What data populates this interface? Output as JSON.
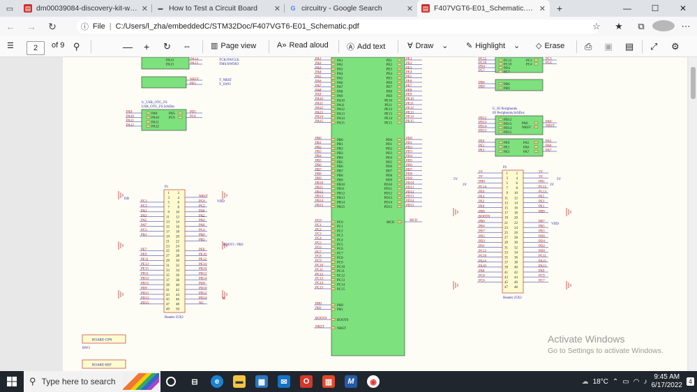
{
  "browser": {
    "tabs": [
      {
        "label": "dm00039084-discovery-kit-with-",
        "icon": "pdf-icon",
        "active": false
      },
      {
        "label": "How to Test a Circuit Board",
        "icon": "site-icon",
        "active": false
      },
      {
        "label": "circuitry - Google Search",
        "icon": "google-icon",
        "active": false
      },
      {
        "label": "F407VGT6-E01_Schematic.pdf",
        "icon": "pdf-icon",
        "active": true
      }
    ],
    "address": {
      "scheme_label": "File",
      "url": "C:/Users/l_zha/embeddedC/STM32Doc/F407VGT6-E01_Schematic.pdf"
    }
  },
  "pdf_toolbar": {
    "page_current": "2",
    "page_total": "of 9",
    "page_view": "Page view",
    "read_aloud": "Read aloud",
    "add_text": "Add text",
    "draw": "Draw",
    "highlight": "Highlight",
    "erase": "Erase"
  },
  "schematic": {
    "usb_block": {
      "title1": "U_USB_OTG_FS",
      "title2": "USB_OTG_FS.SchDoc",
      "pins_left": [
        "PA9",
        "PA10",
        "PA11",
        "PA12"
      ],
      "pins_right": [
        "PD5",
        "PC0"
      ],
      "nets_left": [
        "PA9",
        "PA10",
        "PA11",
        "PA12"
      ],
      "nets_right": [
        "PD5",
        "PC0"
      ]
    },
    "top_left_block": {
      "pins": [
        "PA14",
        "PA13"
      ],
      "nets": [
        "PA14",
        "PA13"
      ],
      "labels": [
        "TCK/SWCLK",
        "TMS/SWDIO"
      ],
      "reset_pins": [
        "NRST",
        "PB3"
      ],
      "reset_nets": [
        "NRST",
        "PB3"
      ],
      "reset_labels": [
        "T_NRST",
        "T_SWO"
      ]
    },
    "io_block": {
      "title1": "U_IO Peripherals",
      "title2": "IO Peripherals.SchDoc",
      "pins_left": [
        "PD12",
        "PD13",
        "PD14",
        "PD15"
      ],
      "pins_right": [
        "PA0",
        "NRST"
      ],
      "nets_right": [
        "PA0",
        "NRST"
      ],
      "pins_left2": [
        "PE0",
        "PE1",
        "PE3"
      ],
      "pins_right2": [
        "PA5",
        "PA6",
        "PA7"
      ],
      "nets_right2": [
        "PA5",
        "PA6",
        "PA7"
      ]
    },
    "top_right_block": {
      "pins_left": [
        "PC12",
        "PC10",
        "PD4",
        "PC7"
      ],
      "pins_right": [
        "PC3",
        "PC4"
      ],
      "pins_left2": [
        "PB6",
        "PB9"
      ]
    },
    "mcu": {
      "label": "MCO",
      "pa_pins": [
        "PA1",
        "PA2",
        "PA3",
        "PA4",
        "PA5",
        "PA6",
        "PA7",
        "PA8",
        "PA9",
        "PA10",
        "PA11",
        "PA12",
        "PA13",
        "PA14",
        "PA15"
      ],
      "pe_pins": [
        "PE1",
        "PE2",
        "PE3",
        "PE4",
        "PE5",
        "PE6",
        "PE7",
        "PE8",
        "PE9",
        "PE10",
        "PE11",
        "PE12",
        "PE13",
        "PE14",
        "PE15"
      ],
      "pb_pins": [
        "PB0",
        "PB1",
        "PB2",
        "PB3",
        "PB4",
        "PB5",
        "PB6",
        "PB7",
        "PB8",
        "PB9",
        "PB10",
        "PB11",
        "PB12",
        "PB13",
        "PB14",
        "PB15"
      ],
      "pd_pins": [
        "PD0",
        "PD1",
        "PD2",
        "PD3",
        "PD4",
        "PD5",
        "PD6",
        "PD7",
        "PD8",
        "PD9",
        "PD10",
        "PD11",
        "PD12",
        "PD13",
        "PD14",
        "PD15"
      ],
      "pc_pins": [
        "PC0",
        "PC1",
        "PC2",
        "PC3",
        "PC4",
        "PC5",
        "PC6",
        "PC7",
        "PC8",
        "PC9",
        "PC10",
        "PC11",
        "PC12",
        "PC13",
        "PC14",
        "PC15"
      ],
      "ph_pins": [
        "PH0",
        "PH1"
      ],
      "boot_pins": [
        "BOOT0",
        "NRST"
      ]
    },
    "p1": {
      "title": "P1",
      "footer": "Header 25X2",
      "vdd": "VDD",
      "dd": "DD",
      "left": [
        "",
        "",
        "PC1",
        "PC3",
        "PA1",
        "PA3",
        "PA5",
        "PA7",
        "PC5",
        "PB1",
        "",
        "",
        "PE7",
        "PE9",
        "PE11",
        "PE13",
        "PE15",
        "PB11",
        "PB13",
        "PB15",
        "PD9",
        "PD11",
        "PD13",
        "PD15",
        ""
      ],
      "right": [
        "",
        "NRST",
        "PC0",
        "PC2",
        "PA0",
        "PA2",
        "PA4",
        "PA6",
        "PC4",
        "PB0",
        "PB2",
        "",
        "PE8",
        "PE10",
        "PE12",
        "PE14",
        "PB10",
        "PB12",
        "PB14",
        "PD8",
        "PD10",
        "PD12",
        "PD14",
        "NC",
        ""
      ],
      "boot_label": "BOOT1 / PB2"
    },
    "p2": {
      "title": "P2",
      "footer": "Header 25X2",
      "v5": "5V",
      "v3": "3V",
      "vdd": "VDD",
      "left": [
        "5V",
        "3V",
        "PH0",
        "PC14",
        "PE6",
        "PE4",
        "PE2",
        "PE0",
        "PB8",
        "BOOT0",
        "PB6",
        "PB4",
        "PD7",
        "PD5",
        "PD3",
        "PD1",
        "PC12",
        "PC10",
        "PA14",
        "PA10",
        "PA8",
        "PC8",
        "PC6",
        ""
      ],
      "right": [
        "5V",
        "3V",
        "PH1",
        "PC15",
        "PC13",
        "PE5",
        "PE3",
        "PE1",
        "PB9",
        "",
        "PB7",
        "PB5",
        "PB3",
        "PD6",
        "PD4",
        "PD2",
        "PD0",
        "PC11",
        "PA15",
        "PA13",
        "PA9",
        "PC9",
        "PC7",
        ""
      ]
    },
    "board_cpn": {
      "label": "BOARD CPN",
      "ref": "HW3"
    },
    "board_ref": {
      "label": "BOARD REF"
    }
  },
  "watermark": {
    "line1": "Activate Windows",
    "line2": "Go to Settings to activate Windows."
  },
  "taskbar": {
    "search_placeholder": "Type here to search",
    "temperature": "18°C",
    "time": "9:45 AM",
    "date": "6/17/2022",
    "notif_count": "4"
  },
  "colors": {
    "pin_green": "#7de17d",
    "net_wire": "#1f1fa8",
    "part_red": "#b01c1c"
  }
}
